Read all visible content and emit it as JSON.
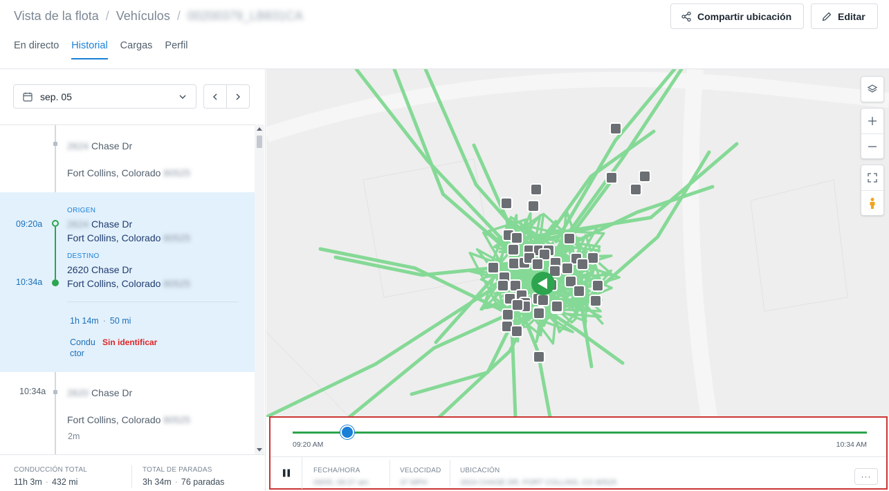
{
  "header": {
    "breadcrumb": [
      "Vista de la flota",
      "Vehículos",
      "00200379_LB831CA"
    ],
    "share_button": "Compartir ubicación",
    "edit_button": "Editar"
  },
  "tabs": [
    {
      "label": "En directo",
      "active": false
    },
    {
      "label": "Historial",
      "active": true
    },
    {
      "label": "Cargas",
      "active": false
    },
    {
      "label": "Perfil",
      "active": false
    }
  ],
  "date_picker": {
    "value": "sep. 05"
  },
  "timeline": {
    "stop_top": {
      "street_num": "2624",
      "street": "Chase Dr",
      "city": "Fort Collins, Colorado",
      "zip": "80525"
    },
    "trip": {
      "origin_label": "ORIGEN",
      "origin_time": "09:20a",
      "origin_street_num": "2624",
      "origin_street": "Chase Dr",
      "origin_city": "Fort Collins, Colorado",
      "origin_zip": "80525",
      "destination_label": "DESTINO",
      "destination_time": "10:34a",
      "destination_street": "2620 Chase Dr",
      "destination_city": "Fort Collins, Colorado",
      "destination_zip": "80525",
      "duration": "1h 14m",
      "distance": "50 mi",
      "driver_label": "Conductor",
      "driver_value": "Sin identificar"
    },
    "stop_bottom": {
      "time": "10:34a",
      "street_num": "2620",
      "street": "Chase Dr",
      "city": "Fort Collins, Colorado",
      "zip": "80525",
      "duration": "2m"
    }
  },
  "footer": {
    "driving_label": "CONDUCCIÓN TOTAL",
    "driving_time": "11h 3m",
    "driving_distance": "432 mi",
    "stops_label": "TOTAL DE PARADAS",
    "stops_time": "3h 34m",
    "stops_count": "76 paradas"
  },
  "playback": {
    "start_time": "09:20 AM",
    "end_time": "10:34 AM",
    "progress": 0.095,
    "datetime_label": "FECHA/HORA",
    "datetime_value": "09/05, 09:27 am",
    "speed_label": "VELOCIDAD",
    "speed_value": "37 MPH",
    "location_label": "UBICACIÓN",
    "location_value": "2624 CHASE DR, FORT COLLINS, CO 80525",
    "more_label": "···"
  },
  "colors": {
    "accent": "#1a7fd6",
    "route": "#7dd88f",
    "trip_bg": "#e3f1fc",
    "unidentified": "#e02424",
    "vehicle_marker": "#2da44e",
    "highlight_border": "#cc3333"
  },
  "icons": [
    "share-icon",
    "pencil-icon",
    "calendar-icon",
    "chevron-down-icon",
    "chevron-left-icon",
    "chevron-right-icon",
    "layers-icon",
    "zoom-in-icon",
    "zoom-out-icon",
    "fullscreen-icon",
    "street-view-icon",
    "pause-icon",
    "vehicle-arrow-icon",
    "stop-marker-icon"
  ]
}
